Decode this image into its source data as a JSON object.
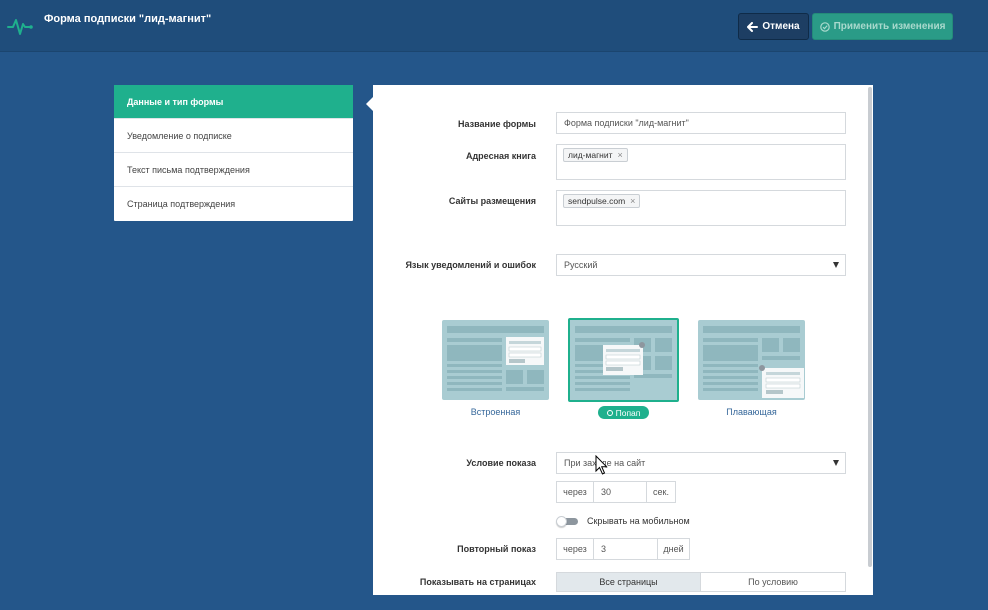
{
  "header": {
    "title": "Форма подписки \"лид-магнит\"",
    "cancel_label": "Отмена",
    "apply_label": "Применить изменения",
    "logo_icon": "pulse-logo-icon",
    "accent": "#1fb08d"
  },
  "nav": {
    "items": [
      {
        "label": "Данные и тип формы",
        "active": true
      },
      {
        "label": "Уведомление о подписке",
        "active": false
      },
      {
        "label": "Текст письма подтверждения",
        "active": false
      },
      {
        "label": "Страница подтверждения",
        "active": false
      }
    ]
  },
  "form": {
    "name": {
      "label": "Название формы",
      "value": "Форма подписки \"лид-магнит\""
    },
    "address_book": {
      "label": "Адресная книга",
      "tags": [
        "лид-магнит"
      ]
    },
    "sites": {
      "label": "Сайты размещения",
      "tags": [
        "sendpulse.com"
      ]
    },
    "language": {
      "label": "Язык уведомлений и ошибок",
      "value": "Русский"
    },
    "types": [
      {
        "label": "Встроенная",
        "selected": false
      },
      {
        "label": "Попап",
        "selected": true
      },
      {
        "label": "Плавающая",
        "selected": false
      }
    ],
    "show_condition": {
      "label": "Условие показа",
      "value": "При заходе на сайт",
      "delay_prefix": "через",
      "delay_value": "30",
      "delay_unit": "сек."
    },
    "hide_mobile": {
      "label": "Скрывать на мобильном",
      "on": false
    },
    "repeat": {
      "label": "Повторный показ",
      "prefix": "через",
      "value": "3",
      "unit": "дней"
    },
    "pages": {
      "label": "Показывать на страницах",
      "options": [
        "Все страницы",
        "По условию"
      ],
      "selected": "Все страницы"
    }
  }
}
